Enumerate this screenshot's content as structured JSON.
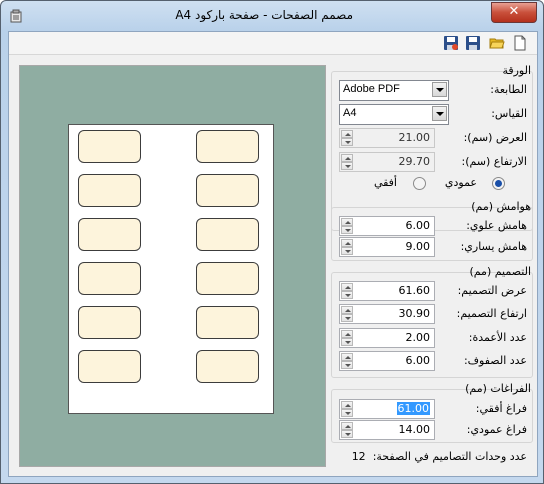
{
  "window": {
    "title": "مصمم الصفحات - صفحة باركود  A4",
    "close_glyph": "✕"
  },
  "paper_group": {
    "title": "الورقة",
    "printer_label": "الطابعة:",
    "printer_value": "Adobe PDF",
    "size_label": "القياس:",
    "size_value": "A4",
    "width_label": "العرض  (سم):",
    "width_value": "21.00",
    "height_label": "الارتفاع (سم):",
    "height_value": "29.70",
    "orientation_portrait": "عمودي",
    "orientation_landscape": "أفقي",
    "orientation_selected": "portrait"
  },
  "margins_group": {
    "title": "هوامش (مم)",
    "top_label": "هامش علوي:",
    "top_value": "6.00",
    "left_label": "هامش يساري:",
    "left_value": "9.00"
  },
  "design_group": {
    "title": "التصميم (مم)",
    "width_label": "عرض التصميم:",
    "width_value": "61.60",
    "height_label": "ارتفاع التصميم:",
    "height_value": "30.90",
    "cols_label": "عدد الأعمدة:",
    "cols_value": "2.00",
    "rows_label": "عدد الصفوف:",
    "rows_value": "6.00"
  },
  "spacing_group": {
    "title": "الفراغات (مم)",
    "horizontal_label": "فراغ أفقي:",
    "horizontal_value": "61.00",
    "vertical_label": "فراغ عمودي:",
    "vertical_value": "14.00"
  },
  "footer": {
    "label": "عدد وحدات التصاميم في الصفحة:",
    "value": "12"
  },
  "toolbar": {
    "icons": [
      "new-file-icon",
      "open-folder-icon",
      "save-icon",
      "save-as-icon"
    ]
  },
  "colors": {
    "preview_bg": "#8fada2",
    "label_fill": "#fdf4dc",
    "selection": "#3399ff"
  }
}
